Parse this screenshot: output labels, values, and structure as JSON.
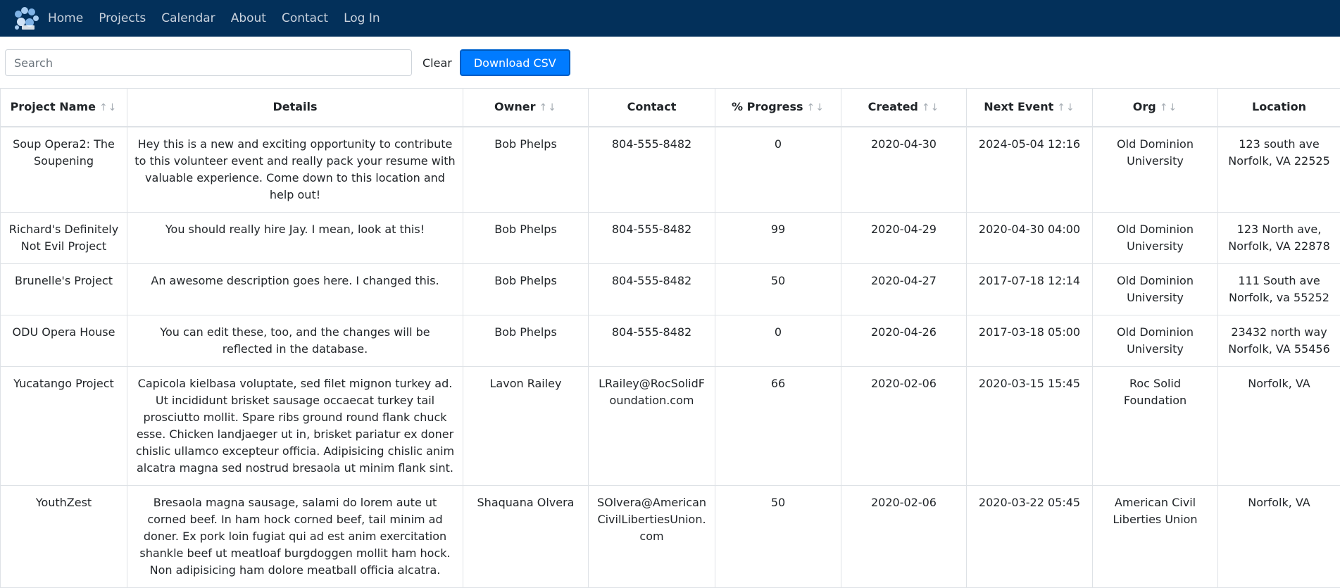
{
  "nav": {
    "logo": "logo-icon",
    "links": [
      "Home",
      "Projects",
      "Calendar",
      "About",
      "Contact",
      "Log In"
    ]
  },
  "toolbar": {
    "search_placeholder": "Search",
    "search_value": "",
    "clear_label": "Clear",
    "csv_label": "Download CSV"
  },
  "table": {
    "columns": [
      {
        "label": "Project Name",
        "sortable": true
      },
      {
        "label": "Details",
        "sortable": false
      },
      {
        "label": "Owner",
        "sortable": true
      },
      {
        "label": "Contact",
        "sortable": false
      },
      {
        "label": "% Progress",
        "sortable": true
      },
      {
        "label": "Created",
        "sortable": true
      },
      {
        "label": "Next Event",
        "sortable": true
      },
      {
        "label": "Org",
        "sortable": true
      },
      {
        "label": "Location",
        "sortable": false
      }
    ],
    "sort_glyph": "↑↓",
    "rows": [
      [
        "Soup Opera2: The Soupening",
        "Hey this is a new and exciting opportunity to contribute to this volunteer event and really pack your resume with valuable experience. Come down to this location and help out!",
        "Bob Phelps",
        "804-555-8482",
        "0",
        "2020-04-30",
        "2024-05-04 12:16",
        "Old Dominion University",
        "123 south ave Norfolk, VA 22525"
      ],
      [
        "Richard's Definitely Not Evil Project",
        "You should really hire Jay. I mean, look at this!",
        "Bob Phelps",
        "804-555-8482",
        "99",
        "2020-04-29",
        "2020-04-30 04:00",
        "Old Dominion University",
        "123 North ave, Norfolk, VA 22878"
      ],
      [
        "Brunelle's Project",
        "An awesome description goes here. I changed this.",
        "Bob Phelps",
        "804-555-8482",
        "50",
        "2020-04-27",
        "2017-07-18 12:14",
        "Old Dominion University",
        "111 South ave Norfolk, va 55252"
      ],
      [
        "ODU Opera House",
        "You can edit these, too, and the changes will be reflected in the database.",
        "Bob Phelps",
        "804-555-8482",
        "0",
        "2020-04-26",
        "2017-03-18 05:00",
        "Old Dominion University",
        "23432 north way Norfolk, VA 55456"
      ],
      [
        "Yucatango Project",
        "Capicola kielbasa voluptate, sed filet mignon turkey ad. Ut incididunt brisket sausage occaecat turkey tail prosciutto mollit. Spare ribs ground round flank chuck esse. Chicken landjaeger ut in, brisket pariatur ex doner chislic ullamco excepteur officia. Adipisicing chislic anim alcatra magna sed nostrud bresaola ut minim flank sint.",
        "Lavon Railey",
        "LRailey@RocSolidFoundation.com",
        "66",
        "2020-02-06",
        "2020-03-15 15:45",
        "Roc Solid Foundation",
        "Norfolk, VA"
      ],
      [
        "YouthZest",
        "Bresaola magna sausage, salami do lorem aute ut corned beef. In ham hock corned beef, tail minim ad doner. Ex pork loin fugiat qui ad est anim exercitation shankle beef ut meatloaf burgdoggen mollit ham hock. Non adipisicing ham dolore meatball officia alcatra.",
        "Shaquana Olvera",
        "SOlvera@AmericanCivilLibertiesUnion.com",
        "50",
        "2020-02-06",
        "2020-03-22 05:45",
        "American Civil Liberties Union",
        "Norfolk, VA"
      ]
    ]
  }
}
